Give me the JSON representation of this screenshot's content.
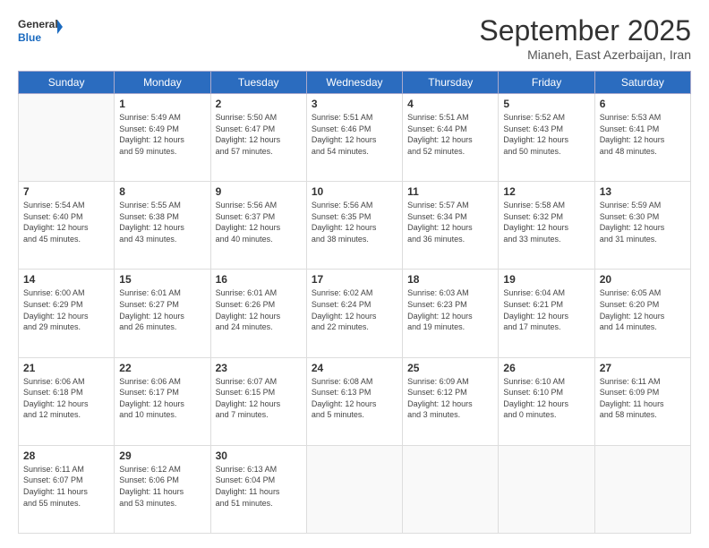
{
  "logo": {
    "line1": "General",
    "line2": "Blue"
  },
  "title": "September 2025",
  "subtitle": "Mianeh, East Azerbaijan, Iran",
  "weekdays": [
    "Sunday",
    "Monday",
    "Tuesday",
    "Wednesday",
    "Thursday",
    "Friday",
    "Saturday"
  ],
  "weeks": [
    [
      {
        "day": "",
        "info": ""
      },
      {
        "day": "1",
        "info": "Sunrise: 5:49 AM\nSunset: 6:49 PM\nDaylight: 12 hours\nand 59 minutes."
      },
      {
        "day": "2",
        "info": "Sunrise: 5:50 AM\nSunset: 6:47 PM\nDaylight: 12 hours\nand 57 minutes."
      },
      {
        "day": "3",
        "info": "Sunrise: 5:51 AM\nSunset: 6:46 PM\nDaylight: 12 hours\nand 54 minutes."
      },
      {
        "day": "4",
        "info": "Sunrise: 5:51 AM\nSunset: 6:44 PM\nDaylight: 12 hours\nand 52 minutes."
      },
      {
        "day": "5",
        "info": "Sunrise: 5:52 AM\nSunset: 6:43 PM\nDaylight: 12 hours\nand 50 minutes."
      },
      {
        "day": "6",
        "info": "Sunrise: 5:53 AM\nSunset: 6:41 PM\nDaylight: 12 hours\nand 48 minutes."
      }
    ],
    [
      {
        "day": "7",
        "info": "Sunrise: 5:54 AM\nSunset: 6:40 PM\nDaylight: 12 hours\nand 45 minutes."
      },
      {
        "day": "8",
        "info": "Sunrise: 5:55 AM\nSunset: 6:38 PM\nDaylight: 12 hours\nand 43 minutes."
      },
      {
        "day": "9",
        "info": "Sunrise: 5:56 AM\nSunset: 6:37 PM\nDaylight: 12 hours\nand 40 minutes."
      },
      {
        "day": "10",
        "info": "Sunrise: 5:56 AM\nSunset: 6:35 PM\nDaylight: 12 hours\nand 38 minutes."
      },
      {
        "day": "11",
        "info": "Sunrise: 5:57 AM\nSunset: 6:34 PM\nDaylight: 12 hours\nand 36 minutes."
      },
      {
        "day": "12",
        "info": "Sunrise: 5:58 AM\nSunset: 6:32 PM\nDaylight: 12 hours\nand 33 minutes."
      },
      {
        "day": "13",
        "info": "Sunrise: 5:59 AM\nSunset: 6:30 PM\nDaylight: 12 hours\nand 31 minutes."
      }
    ],
    [
      {
        "day": "14",
        "info": "Sunrise: 6:00 AM\nSunset: 6:29 PM\nDaylight: 12 hours\nand 29 minutes."
      },
      {
        "day": "15",
        "info": "Sunrise: 6:01 AM\nSunset: 6:27 PM\nDaylight: 12 hours\nand 26 minutes."
      },
      {
        "day": "16",
        "info": "Sunrise: 6:01 AM\nSunset: 6:26 PM\nDaylight: 12 hours\nand 24 minutes."
      },
      {
        "day": "17",
        "info": "Sunrise: 6:02 AM\nSunset: 6:24 PM\nDaylight: 12 hours\nand 22 minutes."
      },
      {
        "day": "18",
        "info": "Sunrise: 6:03 AM\nSunset: 6:23 PM\nDaylight: 12 hours\nand 19 minutes."
      },
      {
        "day": "19",
        "info": "Sunrise: 6:04 AM\nSunset: 6:21 PM\nDaylight: 12 hours\nand 17 minutes."
      },
      {
        "day": "20",
        "info": "Sunrise: 6:05 AM\nSunset: 6:20 PM\nDaylight: 12 hours\nand 14 minutes."
      }
    ],
    [
      {
        "day": "21",
        "info": "Sunrise: 6:06 AM\nSunset: 6:18 PM\nDaylight: 12 hours\nand 12 minutes."
      },
      {
        "day": "22",
        "info": "Sunrise: 6:06 AM\nSunset: 6:17 PM\nDaylight: 12 hours\nand 10 minutes."
      },
      {
        "day": "23",
        "info": "Sunrise: 6:07 AM\nSunset: 6:15 PM\nDaylight: 12 hours\nand 7 minutes."
      },
      {
        "day": "24",
        "info": "Sunrise: 6:08 AM\nSunset: 6:13 PM\nDaylight: 12 hours\nand 5 minutes."
      },
      {
        "day": "25",
        "info": "Sunrise: 6:09 AM\nSunset: 6:12 PM\nDaylight: 12 hours\nand 3 minutes."
      },
      {
        "day": "26",
        "info": "Sunrise: 6:10 AM\nSunset: 6:10 PM\nDaylight: 12 hours\nand 0 minutes."
      },
      {
        "day": "27",
        "info": "Sunrise: 6:11 AM\nSunset: 6:09 PM\nDaylight: 11 hours\nand 58 minutes."
      }
    ],
    [
      {
        "day": "28",
        "info": "Sunrise: 6:11 AM\nSunset: 6:07 PM\nDaylight: 11 hours\nand 55 minutes."
      },
      {
        "day": "29",
        "info": "Sunrise: 6:12 AM\nSunset: 6:06 PM\nDaylight: 11 hours\nand 53 minutes."
      },
      {
        "day": "30",
        "info": "Sunrise: 6:13 AM\nSunset: 6:04 PM\nDaylight: 11 hours\nand 51 minutes."
      },
      {
        "day": "",
        "info": ""
      },
      {
        "day": "",
        "info": ""
      },
      {
        "day": "",
        "info": ""
      },
      {
        "day": "",
        "info": ""
      }
    ]
  ]
}
